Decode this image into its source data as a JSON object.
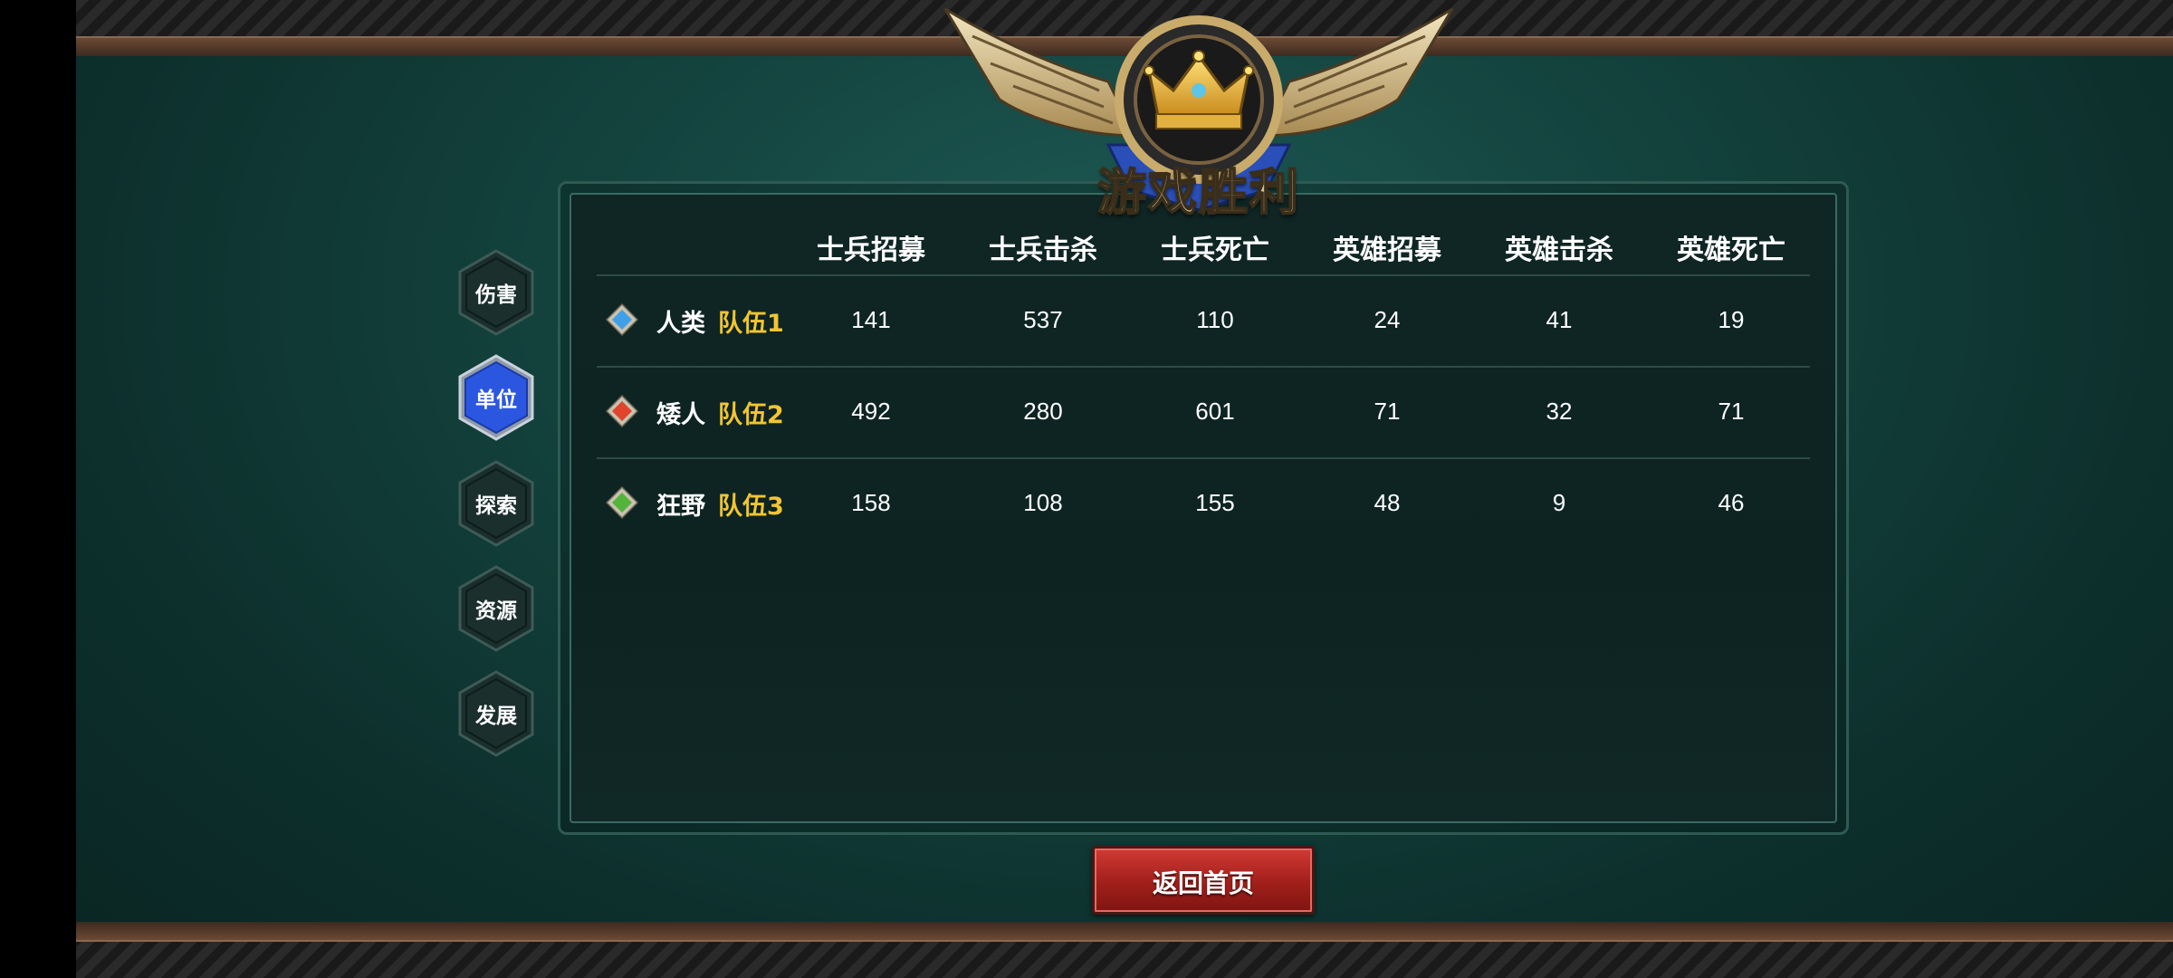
{
  "emblem": {
    "title": "游戏胜利",
    "icon": "crown-winged-emblem"
  },
  "tabs": [
    {
      "label": "伤害",
      "active": false
    },
    {
      "label": "单位",
      "active": true
    },
    {
      "label": "探索",
      "active": false
    },
    {
      "label": "资源",
      "active": false
    },
    {
      "label": "发展",
      "active": false
    }
  ],
  "table": {
    "columns": [
      "士兵招募",
      "士兵击杀",
      "士兵死亡",
      "英雄招募",
      "英雄击杀",
      "英雄死亡"
    ],
    "rows": [
      {
        "race": "人类",
        "team": "队伍1",
        "gem_color": "#3fa0e8",
        "values": [
          "141",
          "537",
          "110",
          "24",
          "41",
          "19"
        ]
      },
      {
        "race": "矮人",
        "team": "队伍2",
        "gem_color": "#e0442c",
        "values": [
          "492",
          "280",
          "601",
          "71",
          "32",
          "71"
        ]
      },
      {
        "race": "狂野",
        "team": "队伍3",
        "gem_color": "#52b43a",
        "values": [
          "158",
          "108",
          "155",
          "48",
          "9",
          "46"
        ]
      }
    ]
  },
  "colors": {
    "team_label": "#f2c531",
    "active_tab": "#2b57e0",
    "inactive_tab": "#1b2f2d",
    "return_button": "#b3241f"
  },
  "return_button": {
    "label": "返回首页"
  }
}
